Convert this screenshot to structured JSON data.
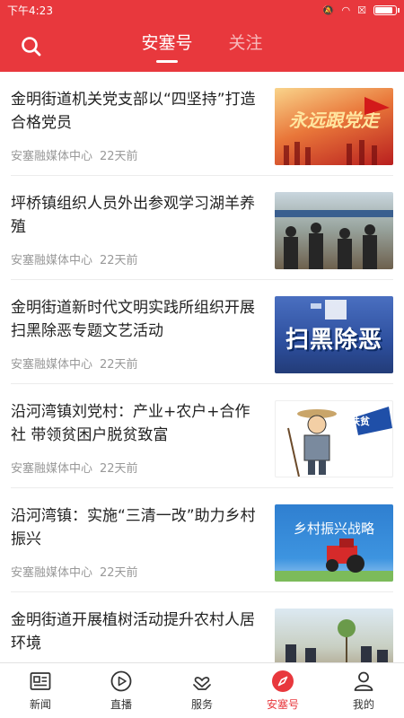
{
  "status_bar": {
    "time": "下午4:23",
    "battery_level": 0.8
  },
  "header": {
    "search_icon": "search-icon",
    "tabs": [
      {
        "label": "安塞号",
        "active": true
      },
      {
        "label": "关注",
        "active": false
      }
    ]
  },
  "feed": {
    "items": [
      {
        "title": "金明街道机关党支部以“四坚持”打造合格党员",
        "source": "安塞融媒体中心",
        "time": "22天前",
        "thumb_text": "永远跟党走"
      },
      {
        "title": "坪桥镇组织人员外出参观学习湖羊养殖",
        "source": "安塞融媒体中心",
        "time": "22天前"
      },
      {
        "title": "金明街道新时代文明实践所组织开展扫黑除恶专题文艺活动",
        "source": "安塞融媒体中心",
        "time": "22天前",
        "thumb_text": "扫黑除恶"
      },
      {
        "title": "沿河湾镇刘党村：产业+农户+合作社 带领贫困户脱贫致富",
        "source": "安塞融媒体中心",
        "time": "22天前",
        "thumb_text": "扶贫"
      },
      {
        "title": "沿河湾镇：实施“三清一改”助力乡村振兴",
        "source": "安塞融媒体中心",
        "time": "22天前",
        "thumb_text": "乡村振兴战略"
      },
      {
        "title": "金明街道开展植树活动提升农村人居环境",
        "source": "",
        "time": ""
      }
    ]
  },
  "bottom_nav": {
    "items": [
      {
        "label": "新闻",
        "icon": "news-icon"
      },
      {
        "label": "直播",
        "icon": "play-icon"
      },
      {
        "label": "服务",
        "icon": "service-icon"
      },
      {
        "label": "安塞号",
        "icon": "compass-icon",
        "active": true
      },
      {
        "label": "我的",
        "icon": "user-icon"
      }
    ]
  },
  "colors": {
    "brand_red": "#e8383d",
    "text": "#222222",
    "meta": "#999999"
  }
}
